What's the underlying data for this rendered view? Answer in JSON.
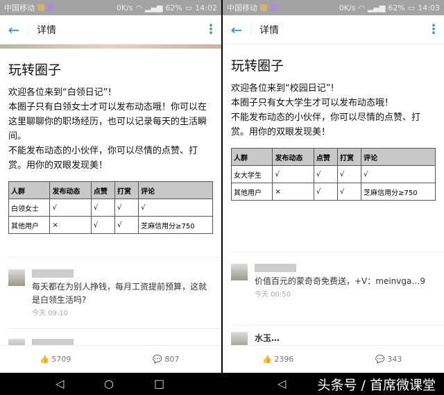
{
  "panels": [
    {
      "status": {
        "carrier": "中国移动",
        "speed": "0K/s",
        "battery": "62%",
        "time": "14:02"
      },
      "header": {
        "title": "详情"
      },
      "title": "玩转圈子",
      "paragraphs": [
        "欢迎各位来到“白领日记”!",
        "本圈子只有白领女士才可以发布动态哦！你可以在这里聊聊你的职场经历，也可以记录每天的生活瞬间。",
        "不能发布动态的小伙伴，你可以尽情的点赞、打赏。用你的双眼发现美！"
      ],
      "table": {
        "headers": [
          "人群",
          "发布动态",
          "点赞",
          "打赏",
          "评论"
        ],
        "rows": [
          [
            "白领女士",
            "√",
            "√",
            "√",
            "√"
          ],
          [
            "其他用户",
            "×",
            "√",
            "√",
            "芝麻信用分≥750"
          ]
        ]
      },
      "comment": {
        "text": "每天都在为别人挣钱，每月工资提前预算，这就是白领生活吗?",
        "time": "今天 09:10"
      },
      "likes": "5709",
      "comments": "807"
    },
    {
      "status": {
        "carrier": "中国移动",
        "speed": "0K/s",
        "battery": "62%",
        "time": "14:03"
      },
      "header": {
        "title": "详情"
      },
      "title": "玩转圈子",
      "paragraphs": [
        "欢迎各位来到“校园日记”!",
        "本圈子只有女大学生才可以发布动态哦！",
        "不能发布动态的小伙伴，你可以尽情的点赞、打赏。用你的双眼发现美！"
      ],
      "table": {
        "headers": [
          "人群",
          "发布动态",
          "点赞",
          "打赏",
          "评论"
        ],
        "rows": [
          [
            "女大学生",
            "√",
            "√",
            "√",
            "√"
          ],
          [
            "其他用户",
            "×",
            "√",
            "√",
            "芝麻信用分≥750"
          ]
        ]
      },
      "comment": {
        "text": "价值百元的蒙奇奇免费送，+V：meinvga…9",
        "time": "今天 00:50"
      },
      "next_name": "水玉…",
      "likes": "2396",
      "comments": "343"
    }
  ],
  "watermark": "头条号 / 首席微课堂"
}
